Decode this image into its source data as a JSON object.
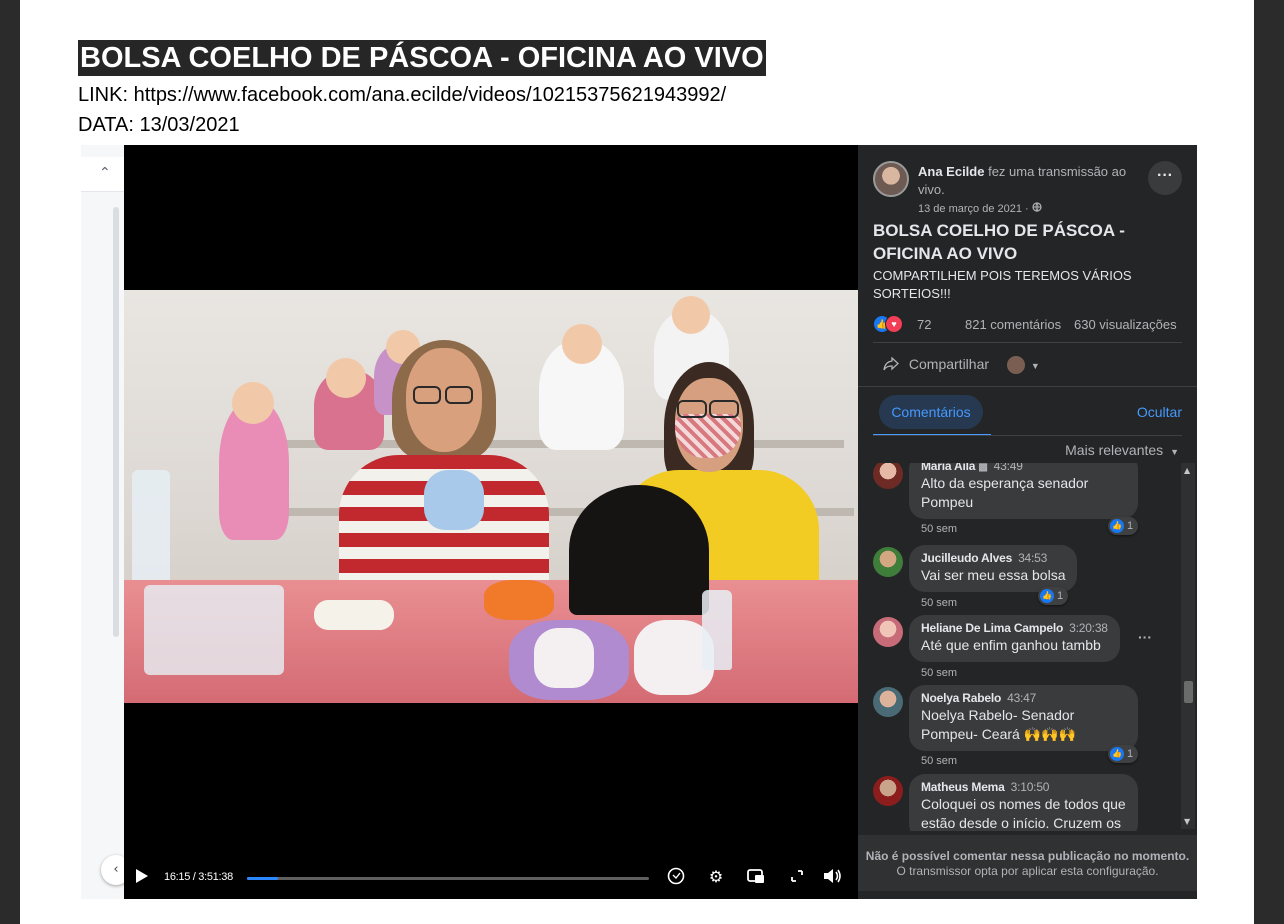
{
  "document": {
    "title": "BOLSA COELHO DE PÁSCOA - OFICINA AO VIVO",
    "link_line": "LINK: https://www.facebook.com/ana.ecilde/videos/10215375621943992/",
    "date_line": "DATA: 13/03/2021"
  },
  "player": {
    "time": "16:15 / 3:51:38",
    "progress_fraction": 0.076
  },
  "post": {
    "author": "Ana Ecilde",
    "action": "fez uma transmissão ao vivo.",
    "date": "13 de março de 2021 · ",
    "title": "BOLSA COELHO DE PÁSCOA - OFICINA AO VIVO",
    "description": "COMPARTILHEM POIS TEREMOS VÁRIOS SORTEIOS!!!",
    "reactions_count": "72",
    "comments_count": "821 comentários",
    "views_count": "630 visualizações",
    "share_label": "Compartilhar",
    "more_label": "···"
  },
  "comments_panel": {
    "tab_label": "Comentários",
    "hide_label": "Ocultar",
    "sort_label": "Mais relevantes",
    "items": [
      {
        "name": "Maria Aila",
        "stamp": "43:49",
        "text": "Alto da esperança senador Pompeu",
        "age": "50 sem",
        "likes": "1"
      },
      {
        "name": "Jucilleudo Alves",
        "stamp": "34:53",
        "text": "Vai ser meu essa bolsa",
        "age": "50 sem",
        "likes": "1"
      },
      {
        "name": "Heliane De Lima Campelo",
        "stamp": "3:20:38",
        "text": "Até que enfim ganhou tambb",
        "age": "50 sem",
        "likes": ""
      },
      {
        "name": "Noelya Rabelo",
        "stamp": "43:47",
        "text": "Noelya Rabelo- Senador Pompeu- Ceará 🙌🙌🙌",
        "age": "50 sem",
        "likes": "1"
      },
      {
        "name": "Matheus Mema",
        "stamp": "3:10:50",
        "text": "Coloquei os nomes de todos que estão desde o início. Cruzem os",
        "age": "",
        "likes": ""
      }
    ],
    "footer_bold": "Não é possível comentar nessa publicação no momento.",
    "footer_note": "O transmissor opta por aplicar esta configuração."
  },
  "icons": {
    "play": "play-icon",
    "captions": "captions-icon",
    "settings": "gear-icon",
    "pip": "picture-in-picture-icon",
    "fullscreen": "fullscreen-icon",
    "volume": "volume-icon",
    "share": "share-icon",
    "globe": "globe-icon",
    "like": "like-icon",
    "love": "love-icon"
  },
  "colors": {
    "accent": "#2d88ff",
    "panel_bg": "#242526",
    "bubble_bg": "#3a3b3c",
    "title_highlight": "#262626"
  }
}
